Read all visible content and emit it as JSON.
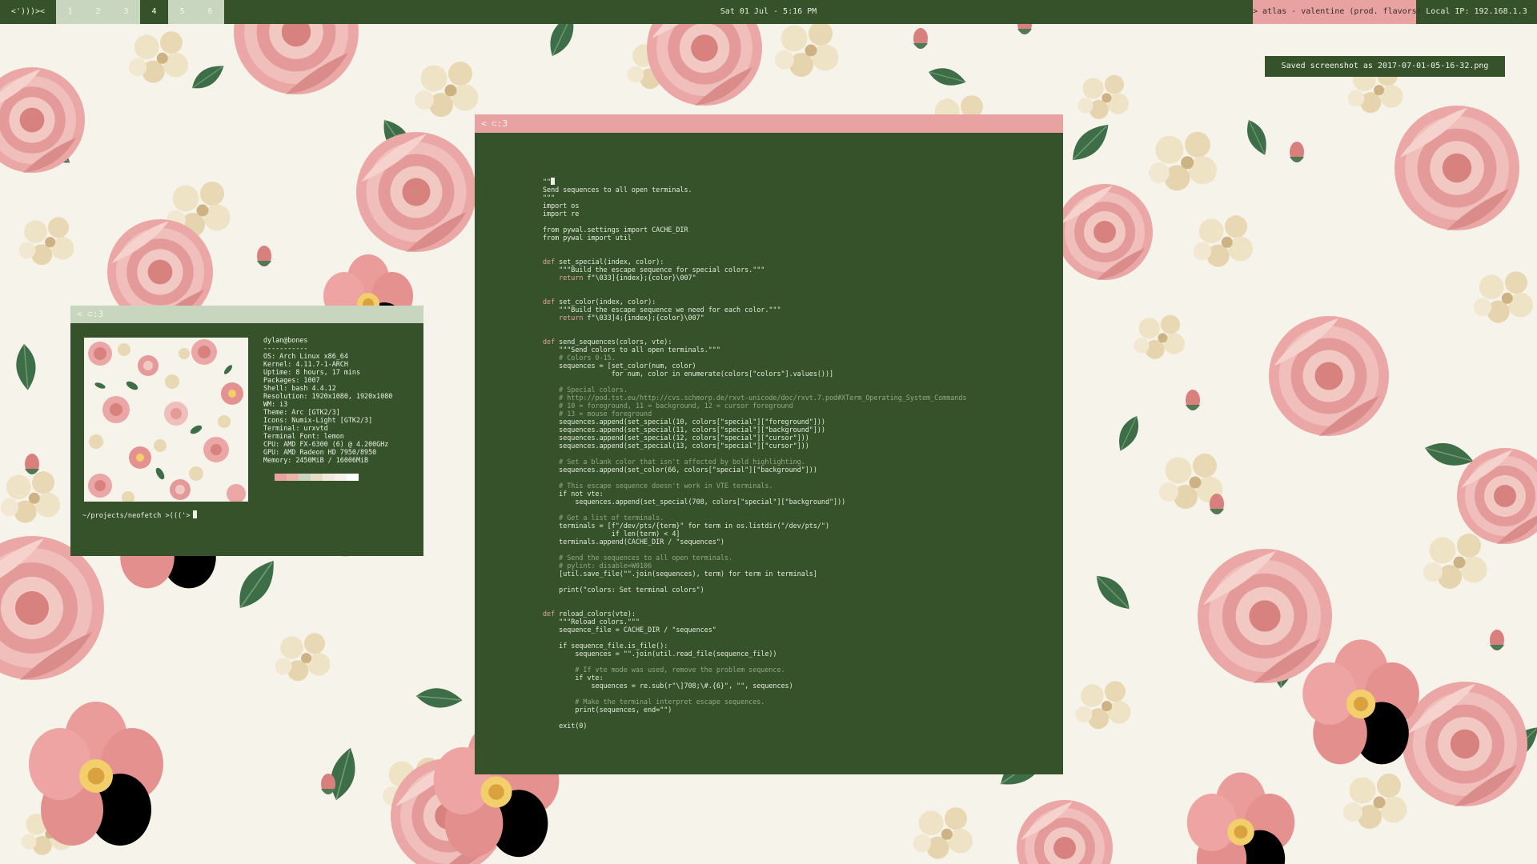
{
  "colors": {
    "bar_bg": "#35522b",
    "accent_pink": "#e8a2a2",
    "workspace_inactive": "#c9d6bf",
    "window_bg": "#35522b",
    "wallpaper_bg": "#f6f3ea"
  },
  "topbar": {
    "logo": "<')))><",
    "workspaces": [
      "1",
      "2",
      "3",
      "4",
      "5",
      "6"
    ],
    "active_workspace": "4",
    "clock": "Sat 01 Jul -  5:16 PM",
    "window_title": "> atlas - valentine (prod. flavors)",
    "local_ip": "Local IP:  192.168.1.3"
  },
  "notification": {
    "text": "Saved screenshot as 2017-07-01-05-16-32.png"
  },
  "neofetch_window": {
    "title": "< ⊂:3",
    "image_icon": "floral-wallpaper-thumbnail",
    "info": [
      "dylan@bones",
      "-----------",
      "OS: Arch Linux x86_64",
      "Kernel: 4.11.7-1-ARCH",
      "Uptime: 8 hours, 17 mins",
      "Packages: 1007",
      "Shell: bash 4.4.12",
      "Resolution: 1920x1080, 1920x1080",
      "WM: i3",
      "Theme: Arc [GTK2/3]",
      "Icons: Numix-Light [GTK2/3]",
      "Terminal: urxvtd",
      "Terminal Font: lemon",
      "CPU: AMD FX-6300 (6) @ 4.200GHz",
      "GPU: AMD Radeon HD 7950/8950",
      "Memory: 2450MiB / 16006MiB"
    ],
    "palette": [
      "#e8a2a2",
      "#e9b6a9",
      "#c9d6bf",
      "#e6dcc8",
      "#f3e9df",
      "#f7f2ee",
      "#ffffff"
    ],
    "prompt": "~/projects/neofetch >((('>"
  },
  "editor_window": {
    "title": "< ⊂:3",
    "code_lines": [
      {
        "t": "\"\"\"",
        "k": "cur"
      },
      {
        "t": "Send sequences to all open terminals."
      },
      {
        "t": "\"\"\""
      },
      {
        "t": "import os"
      },
      {
        "t": "import re"
      },
      {
        "t": ""
      },
      {
        "t": "from pywal.settings import CACHE_DIR"
      },
      {
        "t": "from pywal import util"
      },
      {
        "t": ""
      },
      {
        "t": ""
      },
      {
        "t": "def set_special(index, color):",
        "k": "def"
      },
      {
        "t": "    \"\"\"Build the escape sequence for special colors.\"\"\""
      },
      {
        "t": "    return f\"\\033]{index};{color}\\007\"",
        "k": "ret"
      },
      {
        "t": ""
      },
      {
        "t": ""
      },
      {
        "t": "def set_color(index, color):",
        "k": "def"
      },
      {
        "t": "    \"\"\"Build the escape sequence we need for each color.\"\"\""
      },
      {
        "t": "    return f\"\\033]4;{index};{color}\\007\"",
        "k": "ret"
      },
      {
        "t": ""
      },
      {
        "t": ""
      },
      {
        "t": "def send_sequences(colors, vte):",
        "k": "def"
      },
      {
        "t": "    \"\"\"Send colors to all open terminals.\"\"\""
      },
      {
        "t": "    # Colors 0-15.",
        "k": "cm"
      },
      {
        "t": "    sequences = [set_color(num, color)"
      },
      {
        "t": "                 for num, color in enumerate(colors[\"colors\"].values())]"
      },
      {
        "t": ""
      },
      {
        "t": "    # Special colors.",
        "k": "cm"
      },
      {
        "t": "    # http://pod.tst.eu/http://cvs.schmorp.de/rxvt-unicode/doc/rxvt.7.pod#XTerm_Operating_System_Commands",
        "k": "cm"
      },
      {
        "t": "    # 10 = foreground, 11 = background, 12 = cursor foreground",
        "k": "cm"
      },
      {
        "t": "    # 13 = mouse foreground",
        "k": "cm"
      },
      {
        "t": "    sequences.append(set_special(10, colors[\"special\"][\"foreground\"]))"
      },
      {
        "t": "    sequences.append(set_special(11, colors[\"special\"][\"background\"]))"
      },
      {
        "t": "    sequences.append(set_special(12, colors[\"special\"][\"cursor\"]))"
      },
      {
        "t": "    sequences.append(set_special(13, colors[\"special\"][\"cursor\"]))"
      },
      {
        "t": ""
      },
      {
        "t": "    # Set a blank color that isn't affected by bold highlighting.",
        "k": "cm"
      },
      {
        "t": "    sequences.append(set_color(66, colors[\"special\"][\"background\"]))"
      },
      {
        "t": ""
      },
      {
        "t": "    # This escape sequence doesn't work in VTE terminals.",
        "k": "cm"
      },
      {
        "t": "    if not vte:"
      },
      {
        "t": "        sequences.append(set_special(708, colors[\"special\"][\"background\"]))"
      },
      {
        "t": ""
      },
      {
        "t": "    # Get a list of terminals.",
        "k": "cm"
      },
      {
        "t": "    terminals = [f\"/dev/pts/{term}\" for term in os.listdir(\"/dev/pts/\")"
      },
      {
        "t": "                 if len(term) < 4]"
      },
      {
        "t": "    terminals.append(CACHE_DIR / \"sequences\")"
      },
      {
        "t": ""
      },
      {
        "t": "    # Send the sequences to all open terminals.",
        "k": "cm"
      },
      {
        "t": "    # pylint: disable=W0106",
        "k": "cm"
      },
      {
        "t": "    [util.save_file(\"\".join(sequences), term) for term in terminals]"
      },
      {
        "t": ""
      },
      {
        "t": "    print(\"colors: Set terminal colors\")"
      },
      {
        "t": ""
      },
      {
        "t": ""
      },
      {
        "t": "def reload_colors(vte):",
        "k": "def"
      },
      {
        "t": "    \"\"\"Reload colors.\"\"\""
      },
      {
        "t": "    sequence_file = CACHE_DIR / \"sequences\""
      },
      {
        "t": ""
      },
      {
        "t": "    if sequence_file.is_file():"
      },
      {
        "t": "        sequences = \"\".join(util.read_file(sequence_file))"
      },
      {
        "t": ""
      },
      {
        "t": "        # If vte mode was used, remove the problem sequence.",
        "k": "cm"
      },
      {
        "t": "        if vte:"
      },
      {
        "t": "            sequences = re.sub(r\"\\]708;\\#.{6}\", \"\", sequences)"
      },
      {
        "t": ""
      },
      {
        "t": "        # Make the terminal interpret escape sequences.",
        "k": "cm"
      },
      {
        "t": "        print(sequences, end=\"\")"
      },
      {
        "t": ""
      },
      {
        "t": "    exit(0)"
      }
    ]
  }
}
